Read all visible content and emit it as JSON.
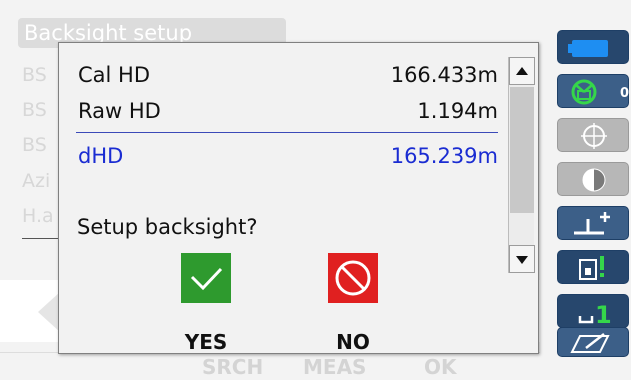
{
  "background": {
    "title": "Backsight setup",
    "rows": [
      "BS",
      "BS",
      "BS",
      "Azi",
      "H.a"
    ],
    "softkeys": [
      "SRCH",
      "MEAS",
      "OK"
    ]
  },
  "side_icons": [
    {
      "icon": "battery-icon"
    },
    {
      "icon": "target-tilt-icon",
      "count": "0"
    },
    {
      "icon": "crosshair-icon"
    },
    {
      "icon": "prism-half-circle-icon"
    },
    {
      "icon": "instrument-height-plus-icon"
    },
    {
      "icon": "memory-card-icon"
    },
    {
      "icon": "face-1-icon"
    },
    {
      "icon": "input-mode-icon"
    }
  ],
  "dialog": {
    "rows": [
      {
        "label": "Cal HD",
        "value": "166.433m"
      },
      {
        "label": "Raw HD",
        "value": "1.194m"
      }
    ],
    "result": {
      "label": "dHD",
      "value": "165.239m"
    },
    "question": "Setup backsight?",
    "yes_label": "YES",
    "no_label": "NO"
  },
  "colors": {
    "accent_blue": "#1a2cd2",
    "yes_green": "#2e9a2e",
    "no_red": "#e02020",
    "side_button_blue": "#27476d"
  }
}
